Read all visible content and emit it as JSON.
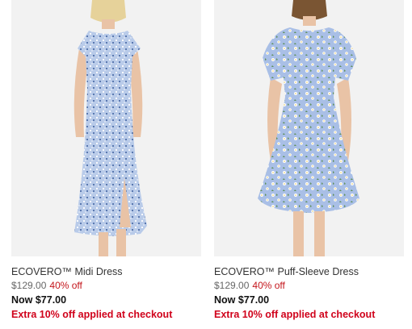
{
  "products": [
    {
      "name": "ECOVERO™ Midi Dress",
      "original_price": "$129.00",
      "discount": "40% off",
      "now_price": "Now $77.00",
      "promo": "Extra 10% off applied at checkout"
    },
    {
      "name": "ECOVERO™ Puff-Sleeve Dress",
      "original_price": "$129.00",
      "discount": "40% off",
      "now_price": "Now $77.00",
      "promo": "Extra 10% off applied at checkout"
    }
  ],
  "colors": {
    "discount_red": "#c4161c",
    "promo_red": "#d0021b",
    "dress_blue": "#a9bfe6"
  }
}
